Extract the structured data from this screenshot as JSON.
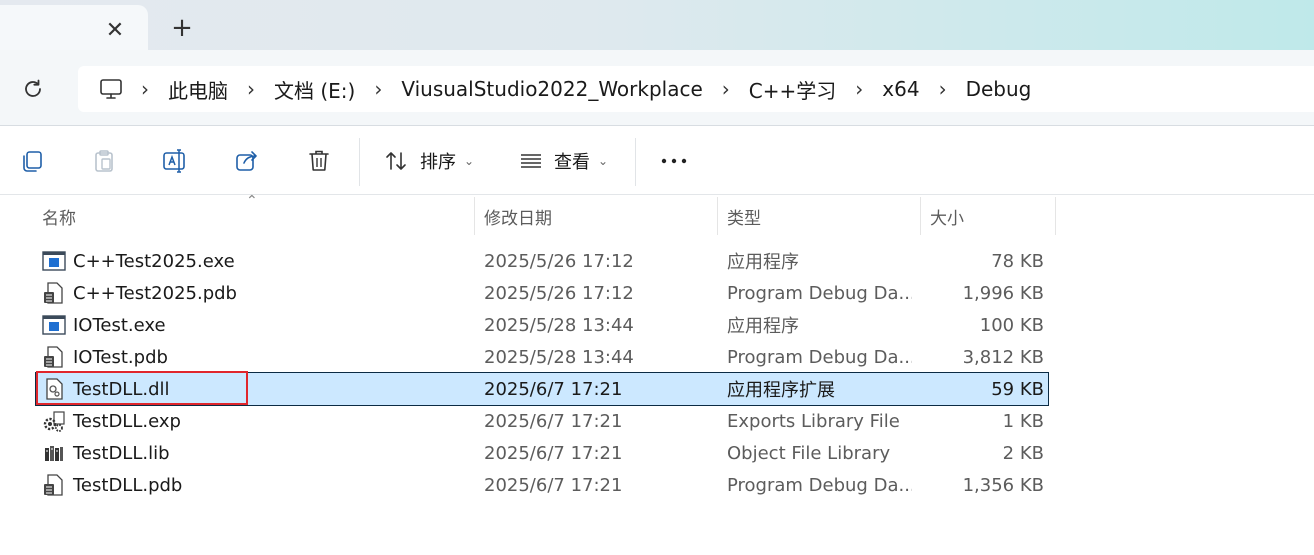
{
  "tabs": {
    "close_glyph": "✕",
    "new_tab_glyph": "+"
  },
  "address": {
    "separator": "›",
    "crumbs": [
      "此电脑",
      "文档 (E:)",
      "ViusualStudio2022_Workplace",
      "C++学习",
      "x64",
      "Debug"
    ]
  },
  "toolbar": {
    "sort_label": "排序",
    "view_label": "查看",
    "more_label": "•••"
  },
  "columns": {
    "name": "名称",
    "date": "修改日期",
    "type": "类型",
    "size": "大小"
  },
  "files": [
    {
      "name": "C++Test2025.exe",
      "date": "2025/5/26 17:12",
      "type": "应用程序",
      "size": "78 KB",
      "icon": "exe-icon"
    },
    {
      "name": "C++Test2025.pdb",
      "date": "2025/5/26 17:12",
      "type": "Program Debug Da...",
      "size": "1,996 KB",
      "icon": "pdb-icon"
    },
    {
      "name": "IOTest.exe",
      "date": "2025/5/28 13:44",
      "type": "应用程序",
      "size": "100 KB",
      "icon": "exe-icon"
    },
    {
      "name": "IOTest.pdb",
      "date": "2025/5/28 13:44",
      "type": "Program Debug Da...",
      "size": "3,812 KB",
      "icon": "pdb-icon"
    },
    {
      "name": "TestDLL.dll",
      "date": "2025/6/7 17:21",
      "type": "应用程序扩展",
      "size": "59 KB",
      "icon": "dll-icon",
      "selected": true
    },
    {
      "name": "TestDLL.exp",
      "date": "2025/6/7 17:21",
      "type": "Exports Library File",
      "size": "1 KB",
      "icon": "exp-icon"
    },
    {
      "name": "TestDLL.lib",
      "date": "2025/6/7 17:21",
      "type": "Object File Library",
      "size": "2 KB",
      "icon": "lib-icon"
    },
    {
      "name": "TestDLL.pdb",
      "date": "2025/6/7 17:21",
      "type": "Program Debug Da...",
      "size": "1,356 KB",
      "icon": "pdb-icon"
    }
  ],
  "colors": {
    "selection": "#cce8ff",
    "highlight": "#e0262c",
    "exe_blue": "#1e6fd1"
  }
}
